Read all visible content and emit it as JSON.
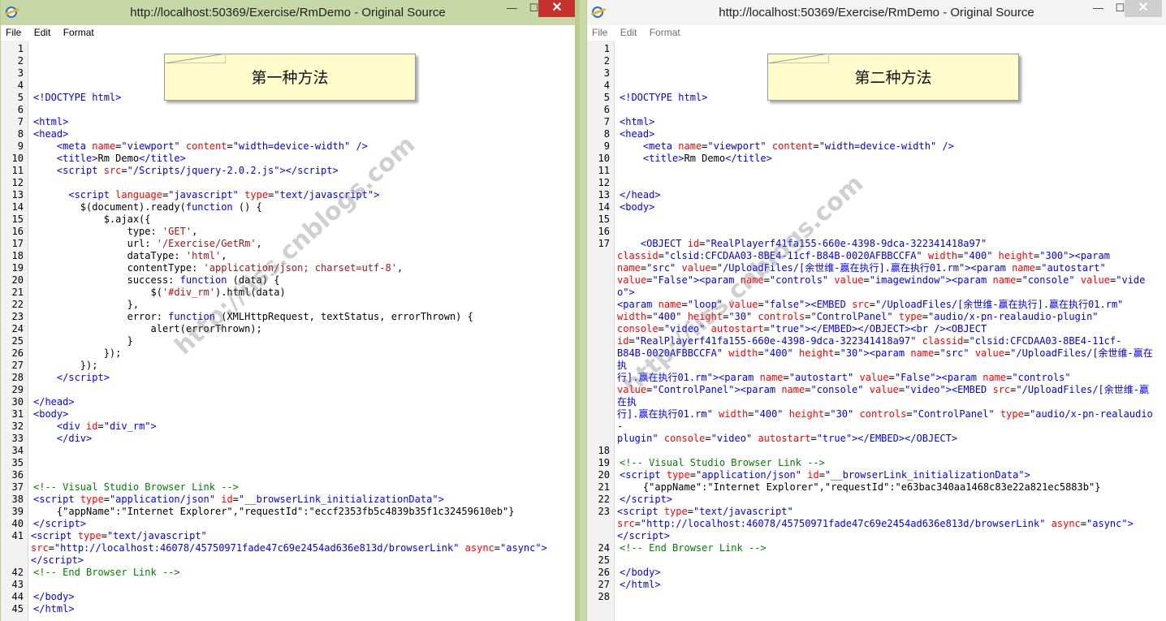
{
  "left_window": {
    "title": "http://localhost:50369/Exercise/RmDemo - Original Source",
    "close_glyph": "✕",
    "min_glyph": "—",
    "max_glyph": "☐",
    "menu": [
      "File",
      "Edit",
      "Format"
    ],
    "note": "第一种方法",
    "lines": [
      {
        "n": "1",
        "html": ""
      },
      {
        "n": "2",
        "html": ""
      },
      {
        "n": "3",
        "html": ""
      },
      {
        "n": "4",
        "html": ""
      },
      {
        "n": "5",
        "html": "<span class='t'>&lt;!DOCTYPE html&gt;</span>"
      },
      {
        "n": "6",
        "html": ""
      },
      {
        "n": "7",
        "html": "<span class='t'>&lt;html&gt;</span>"
      },
      {
        "n": "8",
        "html": "<span class='t'>&lt;head&gt;</span>"
      },
      {
        "n": "9",
        "html": "    <span class='t'>&lt;meta</span> <span class='a'>name</span>=<span class='v'>\"viewport\"</span> <span class='a'>content</span>=<span class='v'>\"width=device-width\"</span> <span class='t'>/&gt;</span>"
      },
      {
        "n": "10",
        "html": "    <span class='t'>&lt;title&gt;</span>Rm Demo<span class='t'>&lt;/title&gt;</span>"
      },
      {
        "n": "11",
        "html": "    <span class='t'>&lt;script</span> <span class='a'>src</span>=<span class='v'>\"/Scripts/jquery-2.0.2.js\"</span><span class='t'>&gt;&lt;/script&gt;</span>"
      },
      {
        "n": "12",
        "html": ""
      },
      {
        "n": "13",
        "html": "      <span class='t'>&lt;script</span> <span class='a'>language</span>=<span class='v'>\"javascript\"</span> <span class='a'>type</span>=<span class='v'>\"text/javascript\"</span><span class='t'>&gt;</span>"
      },
      {
        "n": "14",
        "html": "        $(document).ready(<span class='k'>function</span> () {"
      },
      {
        "n": "15",
        "html": "            $.ajax({"
      },
      {
        "n": "16",
        "html": "                type: <span class='s'>'GET'</span>,"
      },
      {
        "n": "17",
        "html": "                url: <span class='s'>'/Exercise/GetRm'</span>,"
      },
      {
        "n": "18",
        "html": "                dataType: <span class='s'>'html'</span>,"
      },
      {
        "n": "19",
        "html": "                contentType: <span class='s'>'application/json; charset=utf-8'</span>,"
      },
      {
        "n": "20",
        "html": "                success: <span class='k'>function</span> (data) {"
      },
      {
        "n": "21",
        "html": "                    $(<span class='s'>'#div_rm'</span>).html(data)"
      },
      {
        "n": "22",
        "html": "                },"
      },
      {
        "n": "23",
        "html": "                error: <span class='k'>function</span> (XMLHttpRequest, textStatus, errorThrown) {"
      },
      {
        "n": "24",
        "html": "                    alert(errorThrown);"
      },
      {
        "n": "25",
        "html": "                }"
      },
      {
        "n": "26",
        "html": "            });"
      },
      {
        "n": "27",
        "html": "        });"
      },
      {
        "n": "28",
        "html": "    <span class='t'>&lt;/script&gt;</span>"
      },
      {
        "n": "29",
        "html": ""
      },
      {
        "n": "30",
        "html": "<span class='t'>&lt;/head&gt;</span>"
      },
      {
        "n": "31",
        "html": "<span class='t'>&lt;body&gt;</span>"
      },
      {
        "n": "32",
        "html": "    <span class='t'>&lt;div</span> <span class='a'>id</span>=<span class='v'>\"div_rm\"</span><span class='t'>&gt;</span>"
      },
      {
        "n": "33",
        "html": "    <span class='t'>&lt;/div&gt;</span>"
      },
      {
        "n": "34",
        "html": ""
      },
      {
        "n": "35",
        "html": ""
      },
      {
        "n": "36",
        "html": ""
      },
      {
        "n": "37",
        "html": "<span class='c'>&lt;!-- Visual Studio Browser Link --&gt;</span>"
      },
      {
        "n": "38",
        "html": "<span class='t'>&lt;script</span> <span class='a'>type</span>=<span class='v'>\"application/json\"</span> <span class='a'>id</span>=<span class='v'>\"__browserLink_initializationData\"</span><span class='t'>&gt;</span>"
      },
      {
        "n": "39",
        "html": "    {\"appName\":\"Internet Explorer\",\"requestId\":\"eccf2353fb5c4839b35f1c32459610eb\"}"
      },
      {
        "n": "40",
        "html": "<span class='t'>&lt;/script&gt;</span>"
      },
      {
        "n": "41",
        "wrap": true,
        "html": "<span class='t'>&lt;script</span> <span class='a'>type</span>=<span class='v'>\"text/javascript\"</span>\n<span class='a'>src</span>=<span class='v'>\"http://localhost:46078/45750971fade47c69e2454ad636e813d/browserLink\"</span> <span class='a'>async</span>=<span class='v'>\"async\"</span><span class='t'>&gt;</span>\n<span class='t'>&lt;/script&gt;</span>"
      },
      {
        "n": "42",
        "html": "<span class='c'>&lt;!-- End Browser Link --&gt;</span>"
      },
      {
        "n": "43",
        "html": ""
      },
      {
        "n": "44",
        "html": "<span class='t'>&lt;/body&gt;</span>"
      },
      {
        "n": "45",
        "html": "<span class='t'>&lt;/html&gt;</span>"
      }
    ]
  },
  "right_window": {
    "title": "http://localhost:50369/Exercise/RmDemo - Original Source",
    "close_glyph": "✕",
    "min_glyph": "—",
    "max_glyph": "☐",
    "menu": [
      "File",
      "Edit",
      "Format"
    ],
    "note": "第二种方法",
    "lines": [
      {
        "n": "1",
        "html": ""
      },
      {
        "n": "2",
        "html": ""
      },
      {
        "n": "3",
        "html": ""
      },
      {
        "n": "4",
        "html": ""
      },
      {
        "n": "5",
        "html": "<span class='t'>&lt;!DOCTYPE html&gt;</span>"
      },
      {
        "n": "6",
        "html": ""
      },
      {
        "n": "7",
        "html": "<span class='t'>&lt;html&gt;</span>"
      },
      {
        "n": "8",
        "html": "<span class='t'>&lt;head&gt;</span>"
      },
      {
        "n": "9",
        "html": "    <span class='t'>&lt;meta</span> <span class='a'>name</span>=<span class='v'>\"viewport\"</span> <span class='a'>content</span>=<span class='v'>\"width=device-width\"</span> <span class='t'>/&gt;</span>"
      },
      {
        "n": "10",
        "html": "    <span class='t'>&lt;title&gt;</span>Rm Demo<span class='t'>&lt;/title&gt;</span>"
      },
      {
        "n": "11",
        "html": ""
      },
      {
        "n": "12",
        "html": ""
      },
      {
        "n": "13",
        "html": "<span class='t'>&lt;/head&gt;</span>"
      },
      {
        "n": "14",
        "html": "<span class='t'>&lt;body&gt;</span>"
      },
      {
        "n": "15",
        "html": ""
      },
      {
        "n": "16",
        "html": ""
      },
      {
        "n": "17",
        "wrap": true,
        "html": "    <span class='t'>&lt;OBJECT</span> <span class='a'>id</span>=<span class='v'>\"RealPlayerf41fa155-660e-4398-9dca-322341418a97\"</span>\n<span class='a'>classid</span>=<span class='v'>\"clsid:CFCDAA03-8BE4-11cf-B84B-0020AFBBCCFA\"</span> <span class='a'>width</span>=<span class='v'>\"400\"</span> <span class='a'>height</span>=<span class='v'>\"300\"</span><span class='t'>&gt;&lt;param</span>\n<span class='a'>name</span>=<span class='v'>\"src\"</span> <span class='a'>value</span>=<span class='v'>\"/UploadFiles/[余世维-赢在执行].赢在执行01.rm\"</span><span class='t'>&gt;&lt;param</span> <span class='a'>name</span>=<span class='v'>\"autostart\"</span>\n<span class='a'>value</span>=<span class='v'>\"False\"</span><span class='t'>&gt;&lt;param</span> <span class='a'>name</span>=<span class='v'>\"controls\"</span> <span class='a'>value</span>=<span class='v'>\"imagewindow\"</span><span class='t'>&gt;&lt;param</span> <span class='a'>name</span>=<span class='v'>\"console\"</span> <span class='a'>value</span>=<span class='v'>\"video\"</span><span class='t'>&gt;</span>\n<span class='t'>&lt;param</span> <span class='a'>name</span>=<span class='v'>\"loop\"</span> <span class='a'>value</span>=<span class='v'>\"false\"</span><span class='t'>&gt;&lt;EMBED</span> <span class='a'>src</span>=<span class='v'>\"/UploadFiles/[余世维-赢在执行].赢在执行01.rm\"</span>\n<span class='a'>width</span>=<span class='v'>\"400\"</span> <span class='a'>height</span>=<span class='v'>\"30\"</span> <span class='a'>controls</span>=<span class='v'>\"ControlPanel\"</span> <span class='a'>type</span>=<span class='v'>\"audio/x-pn-realaudio-plugin\"</span>\n<span class='a'>console</span>=<span class='v'>\"video\"</span> <span class='a'>autostart</span>=<span class='v'>\"true\"</span><span class='t'>&gt;&lt;/EMBED&gt;&lt;/OBJECT&gt;&lt;br /&gt;&lt;OBJECT</span>\n<span class='a'>id</span>=<span class='v'>\"RealPlayerf41fa155-660e-4398-9dca-322341418a97\"</span> <span class='a'>classid</span>=<span class='v'>\"clsid:CFCDAA03-8BE4-11cf-</span>\n<span class='v'>B84B-0020AFBBCCFA\"</span> <span class='a'>width</span>=<span class='v'>\"400\"</span> <span class='a'>height</span>=<span class='v'>\"30\"</span><span class='t'>&gt;&lt;param</span> <span class='a'>name</span>=<span class='v'>\"src\"</span> <span class='a'>value</span>=<span class='v'>\"/UploadFiles/[余世维-赢在执</span>\n<span class='v'>行].赢在执行01.rm\"</span><span class='t'>&gt;&lt;param</span> <span class='a'>name</span>=<span class='v'>\"autostart\"</span> <span class='a'>value</span>=<span class='v'>\"False\"</span><span class='t'>&gt;&lt;param</span> <span class='a'>name</span>=<span class='v'>\"controls\"</span>\n<span class='a'>value</span>=<span class='v'>\"ControlPanel\"</span><span class='t'>&gt;&lt;param</span> <span class='a'>name</span>=<span class='v'>\"console\"</span> <span class='a'>value</span>=<span class='v'>\"video\"</span><span class='t'>&gt;&lt;EMBED</span> <span class='a'>src</span>=<span class='v'>\"/UploadFiles/[余世维-赢在执</span>\n<span class='v'>行].赢在执行01.rm\"</span> <span class='a'>width</span>=<span class='v'>\"400\"</span> <span class='a'>height</span>=<span class='v'>\"30\"</span> <span class='a'>controls</span>=<span class='v'>\"ControlPanel\"</span> <span class='a'>type</span>=<span class='v'>\"audio/x-pn-realaudio-</span>\n<span class='v'>plugin\"</span> <span class='a'>console</span>=<span class='v'>\"video\"</span> <span class='a'>autostart</span>=<span class='v'>\"true\"</span><span class='t'>&gt;&lt;/EMBED&gt;&lt;/OBJECT&gt;</span>"
      },
      {
        "n": "18",
        "html": ""
      },
      {
        "n": "19",
        "html": "<span class='c'>&lt;!-- Visual Studio Browser Link --&gt;</span>"
      },
      {
        "n": "20",
        "html": "<span class='t'>&lt;script</span> <span class='a'>type</span>=<span class='v'>\"application/json\"</span> <span class='a'>id</span>=<span class='v'>\"__browserLink_initializationData\"</span><span class='t'>&gt;</span>"
      },
      {
        "n": "21",
        "html": "    {\"appName\":\"Internet Explorer\",\"requestId\":\"e63bac340aa1468c83e22a821ec5883b\"}"
      },
      {
        "n": "22",
        "html": "<span class='t'>&lt;/script&gt;</span>"
      },
      {
        "n": "23",
        "wrap": true,
        "html": "<span class='t'>&lt;script</span> <span class='a'>type</span>=<span class='v'>\"text/javascript\"</span>\n<span class='a'>src</span>=<span class='v'>\"http://localhost:46078/45750971fade47c69e2454ad636e813d/browserLink\"</span> <span class='a'>async</span>=<span class='v'>\"async\"</span><span class='t'>&gt;</span>\n<span class='t'>&lt;/script&gt;</span>"
      },
      {
        "n": "24",
        "html": "<span class='c'>&lt;!-- End Browser Link --&gt;</span>"
      },
      {
        "n": "25",
        "html": ""
      },
      {
        "n": "26",
        "html": "<span class='t'>&lt;/body&gt;</span>"
      },
      {
        "n": "27",
        "html": "<span class='t'>&lt;/html&gt;</span>"
      },
      {
        "n": "28",
        "html": ""
      }
    ]
  },
  "watermark": "http://iiss.cnblogs.com"
}
